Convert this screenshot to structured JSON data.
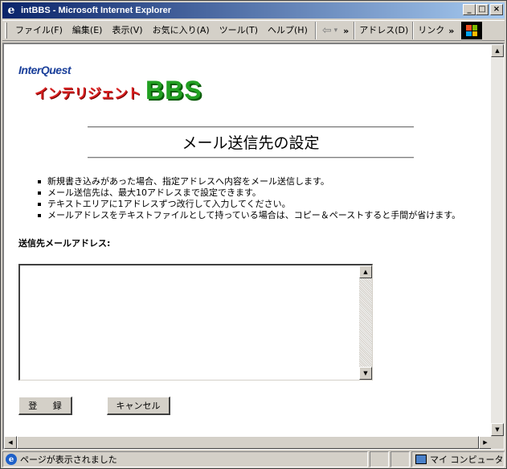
{
  "window": {
    "title": "intBBS - Microsoft Internet Explorer",
    "title_icon": "e",
    "minimize": "_",
    "maximize": "□",
    "close": "×"
  },
  "menu": {
    "items": [
      "ファイル(F)",
      "編集(E)",
      "表示(V)",
      "お気に入り(A)",
      "ツール(T)",
      "ヘルプ(H)"
    ],
    "back_arrow": "⇦",
    "back_dropdown": "▾",
    "chevron": "»",
    "address_label": "アドレス(D)",
    "links_label": "リンク"
  },
  "logo": {
    "top_text": "InterQuest",
    "katakana": "インテリジェント",
    "bbs": "BBS"
  },
  "page": {
    "title": "メール送信先の設定",
    "bullets": [
      "新規書き込みがあった場合、指定アドレスへ内容をメール送信します。",
      "メール送信先は、最大10アドレスまで設定できます。",
      "テキストエリアに1アドレスずつ改行して入力してください。",
      "メールアドレスをテキストファイルとして持っている場合は、コピー＆ペーストすると手間が省けます。"
    ],
    "field_label": "送信先メールアドレス:",
    "textarea_value": "",
    "register_button": "登 録",
    "cancel_button": "キャンセル"
  },
  "scroll": {
    "up": "▲",
    "down": "▼",
    "left": "◀",
    "right": "▶"
  },
  "status": {
    "message": "ページが表示されました",
    "zone": "マイ コンピュータ"
  }
}
